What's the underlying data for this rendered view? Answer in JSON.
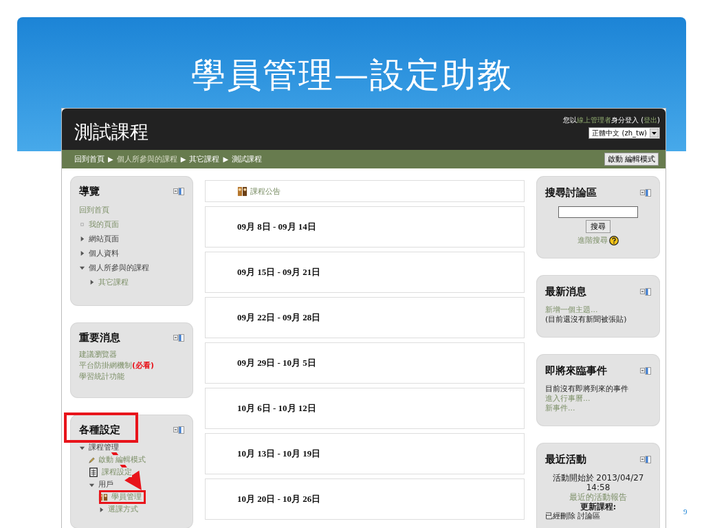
{
  "slide": {
    "title": "學員管理—設定助教",
    "page_number": "9"
  },
  "site": {
    "course_title": "測試課程",
    "login": {
      "before": "您以",
      "user": "線上管理者",
      "middle": "身分登入 (",
      "logout": "登出",
      "after": ")"
    },
    "language": "正體中文 (zh_tw)",
    "breadcrumb": [
      {
        "label": "回到首頁",
        "visited": false
      },
      {
        "separator": "▶",
        "label": "個人所參與的課程",
        "visited": true
      },
      {
        "separator": "▶",
        "label": "其它課程",
        "visited": false
      },
      {
        "separator": "▶",
        "label": "測試課程",
        "visited": false
      }
    ],
    "edit_button": "啟動 編輯模式"
  },
  "left_blocks": [
    {
      "title": "導覽",
      "highlighted": false,
      "items": [
        {
          "label": "回到首頁",
          "kind": "plain",
          "link": true
        },
        {
          "label": "我的頁面",
          "kind": "leaf",
          "link": true
        },
        {
          "label": "網站頁面",
          "kind": "branch",
          "expanded": false,
          "link": false
        },
        {
          "label": "個人資料",
          "kind": "branch",
          "expanded": false,
          "link": false
        },
        {
          "label": "個人所參與的課程",
          "kind": "branch",
          "expanded": true,
          "link": false,
          "children": [
            {
              "label": "其它課程",
              "kind": "branch",
              "expanded": false,
              "link": true
            }
          ]
        }
      ]
    },
    {
      "title": "重要消息",
      "highlighted": false,
      "items": [
        {
          "label": "建議瀏覽器",
          "kind": "plain",
          "link": true
        },
        {
          "label": "平台防掛網機制**(必看)**",
          "kind": "plain",
          "link": true
        },
        {
          "label": "學習統計功能",
          "kind": "plain",
          "link": true
        }
      ]
    },
    {
      "title": "各種設定",
      "highlighted": true,
      "items": [
        {
          "label": "課程管理",
          "kind": "branch",
          "expanded": true,
          "link": false,
          "children": [
            {
              "label": "啟動 編輯模式",
              "kind": "edit",
              "link": true
            },
            {
              "label": "課程設定",
              "kind": "settings",
              "link": true
            },
            {
              "label": "用戶",
              "kind": "branch",
              "expanded": true,
              "link": false,
              "children": [
                {
                  "label": "學員管理",
                  "kind": "roster",
                  "link": true,
                  "highlighted": true
                },
                {
                  "label": "選課方式",
                  "kind": "branch",
                  "expanded": false,
                  "link": true
                }
              ]
            }
          ]
        }
      ]
    }
  ],
  "sections": {
    "announcement": "課程公告",
    "weeks": [
      "09月 8日 - 09月 14日",
      "09月 15日 - 09月 21日",
      "09月 22日 - 09月 28日",
      "09月 29日 - 10月 5日",
      "10月 6日 - 10月 12日",
      "10月 13日 - 10月 19日",
      "10月 20日 - 10月 26日"
    ]
  },
  "right_blocks": [
    {
      "title": "搜尋討論區",
      "kind": "search",
      "button": "搜尋",
      "link": "進階搜尋"
    },
    {
      "title": "最新消息",
      "kind": "lines",
      "lines": [
        {
          "text": "新增一個主題...",
          "kind": "link"
        },
        {
          "text": "(目前還沒有新聞被張貼)",
          "kind": "text"
        }
      ]
    },
    {
      "title": "即將來臨事件",
      "kind": "lines",
      "lines": [
        {
          "text": "目前沒有即將到來的事件",
          "kind": "text"
        },
        {
          "text": "進入行事曆...",
          "kind": "link"
        },
        {
          "text": "新事件...",
          "kind": "link"
        }
      ]
    },
    {
      "title": "最近活動",
      "kind": "lines",
      "lines": [
        {
          "text": "活動開始於 2013/04/27 14:58",
          "kind": "center"
        },
        {
          "text": "最近的活動報告",
          "kind": "center-link"
        },
        {
          "text": "更新課程:",
          "kind": "heading"
        },
        {
          "text": "已經刪除 討論區",
          "kind": "text"
        }
      ]
    }
  ]
}
